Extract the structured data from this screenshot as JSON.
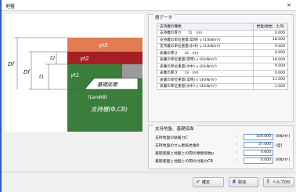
{
  "window": {
    "title": "地盤"
  },
  "diagram": {
    "labels": {
      "df_outer": "Df",
      "df_inner": "Df",
      "t2": "t2",
      "t1": "t1",
      "g3": "γt3",
      "g2": "γt2",
      "g1": "γt1",
      "base": "基礎底面",
      "tan": "(tanΦB)",
      "support": "支持層(Φ,CB)"
    },
    "colors": {
      "top": "#e07d52",
      "mid": "#a61f25",
      "support": "#3b7d3b"
    }
  },
  "layer_data": {
    "legend": "層データ",
    "headers": {
      "type": "支持層の種類",
      "value": "岩盤(軟岩、土丹)"
    },
    "rows": [
      {
        "label": "支持層の厚さ　　t1　(m)",
        "value": "0.000"
      },
      {
        "label": "支持層の単位重量(常時) γ t1(kN/m³)",
        "value": "18.000"
      },
      {
        "label": "支持層の単位重量(水中) γ t1(kN/m³)",
        "value": "9.000"
      },
      {
        "label": "表層の厚さ　　t2　(m)",
        "value": "0.000"
      },
      {
        "label": "表層の単位重量(常時) γ t2(kN/m³)",
        "value": "18.000"
      },
      {
        "label": "表層の単位重量(水中) γ t2(kN/m³)",
        "value": "9.000"
      },
      {
        "label": "表層の厚さ　　t3　(m)",
        "value": "0.000"
      },
      {
        "label": "表層の単位重量(常時) γ t3(kN/m³)",
        "value": "11.000"
      },
      {
        "label": "表層の単位重量(水中) γ t3(kN/m³)",
        "value": "1.000"
      }
    ]
  },
  "foundation": {
    "legend": "支持地盤、基礎底面",
    "rows": [
      {
        "label": "支持地盤の粘着力C",
        "value": "100.000",
        "unit": "(kN/m²)"
      },
      {
        "label": "支持地盤のせん断抵抗角Φ",
        "value": "37.000",
        "unit": "(度)"
      },
      {
        "label": "基礎底面と地盤との間の摩擦係数μ",
        "value": "0.600",
        "unit": ""
      },
      {
        "label": "基礎底面と地盤との間の付着力CB",
        "value": "0.000",
        "unit": "(kN/m²)"
      }
    ]
  },
  "buttons": {
    "ok": "確定",
    "cancel": "取消",
    "help": "ヘルプ(H)"
  }
}
